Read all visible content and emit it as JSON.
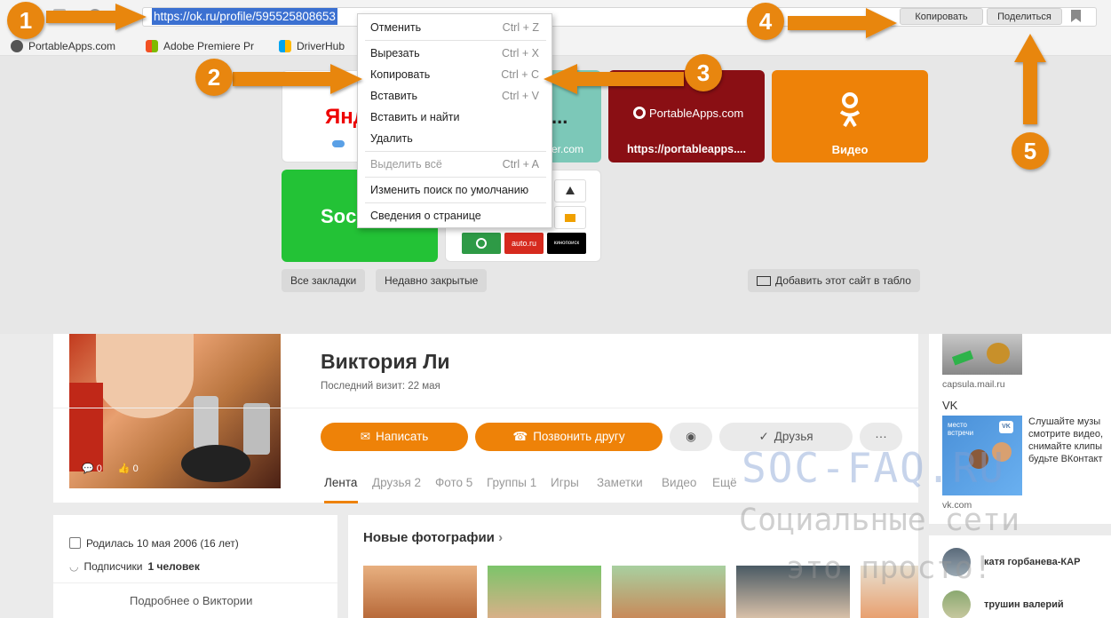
{
  "browser": {
    "url": "https://ok.ru/profile/595525808653",
    "copy_button": "Копировать",
    "share_button": "Поделиться",
    "bookmarks": [
      "PortableApps.com",
      "Adobe Premiere Pr",
      "DriverHub"
    ]
  },
  "context_menu": {
    "items": [
      {
        "label": "Отменить",
        "shortcut": "Ctrl + Z"
      },
      {
        "label": "Вырезать",
        "shortcut": "Ctrl + X"
      },
      {
        "label": "Копировать",
        "shortcut": "Ctrl + C"
      },
      {
        "label": "Вставить",
        "shortcut": "Ctrl + V"
      },
      {
        "label": "Вставить и найти",
        "shortcut": ""
      },
      {
        "label": "Удалить",
        "shortcut": ""
      },
      {
        "label": "Выделить всё",
        "shortcut": "Ctrl + A"
      },
      {
        "label": "Изменить поиск по умолчанию",
        "shortcut": ""
      },
      {
        "label": "Сведения о странице",
        "shortcut": ""
      }
    ]
  },
  "tableau": {
    "tile_yandex_text": "Янд",
    "tile_teal_text": "...",
    "tile_teal_sub": "er.com",
    "tile_portable_logo": "PortableApps.com",
    "tile_portable_label": "https://portableapps....",
    "tile_ok_label": "Видео",
    "tile_soc_text": "Soc",
    "mini_auto": "auto.ru",
    "mini_black": "кинопоиск",
    "all_bookmarks": "Все закладки",
    "recently_closed": "Недавно закрытые",
    "add_site": "Добавить этот сайт в табло"
  },
  "profile": {
    "name": "Виктория Ли",
    "last_visit": "Последний визит: 22 мая",
    "write_button": "Написать",
    "call_button": "Позвонить другу",
    "friends_button": "Друзья",
    "photo_likes": "0",
    "photo_comments": "0",
    "tabs": [
      "Лента",
      "Друзья 2",
      "Фото 5",
      "Группы 1",
      "Игры",
      "Заметки",
      "Видео",
      "Ещё"
    ],
    "birth": "Родилась 10 мая 2006 (16 лет)",
    "subscribers_label": "Подписчики",
    "subscribers_count": "1 человек",
    "more_about": "Подробнее о Виктории",
    "new_photos": "Новые фотографии"
  },
  "sidebar": {
    "ad1_domain": "capsula.mail.ru",
    "vk_title": "VK",
    "vk_ad_text": "Слушайте музы смотрите видео, снимайте клипы будьте ВКонтакт",
    "vk_ad_badge": "место встречи",
    "vk_domain": "vk.com",
    "friends": [
      "катя горбанева-КАР",
      "трушин валерий"
    ]
  },
  "watermark": {
    "line1": "SOC-FAQ.RU",
    "line2": "Социальные сети",
    "line3": "это просто!"
  },
  "annotations": [
    "1",
    "2",
    "3",
    "4",
    "5"
  ],
  "colors": {
    "accent": "#ee8208",
    "annotation": "#e8860f",
    "selection": "#3b70d1"
  }
}
